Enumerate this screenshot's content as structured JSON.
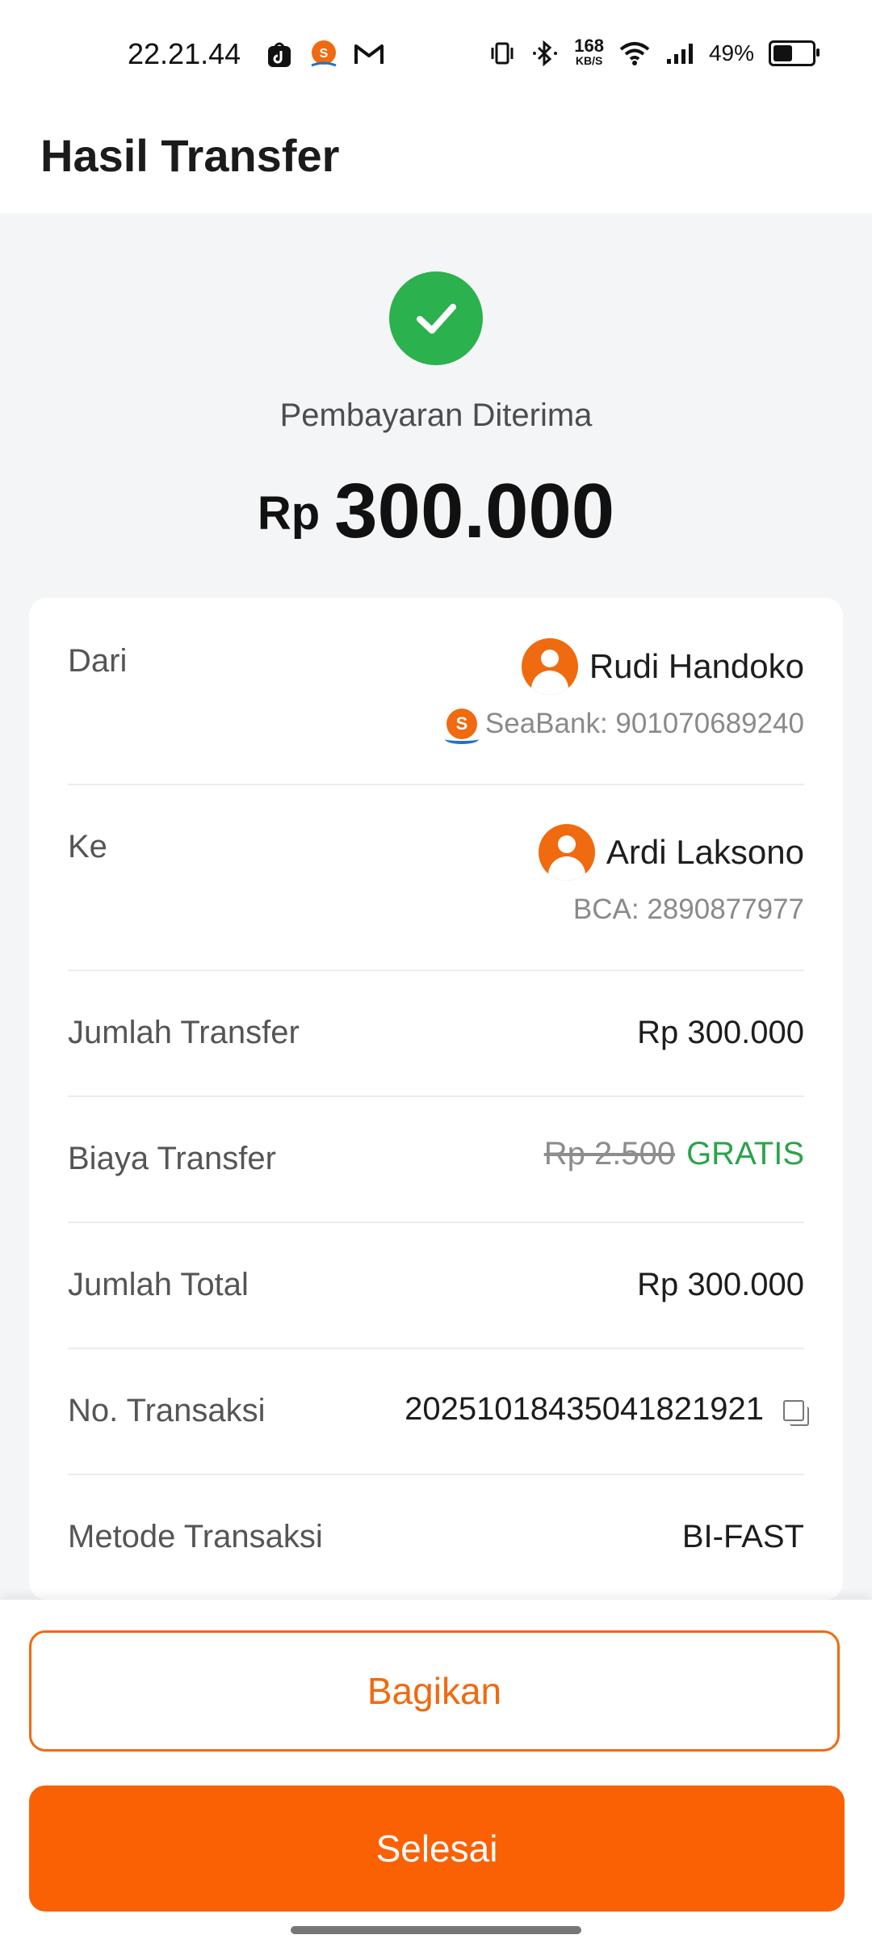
{
  "status_bar": {
    "time": "22.21.44",
    "net_speed_value": "168",
    "net_speed_unit": "KB/S",
    "battery_percent": "49%",
    "battery_level": 0.49
  },
  "header": {
    "title": "Hasil Transfer"
  },
  "result": {
    "status_text": "Pembayaran Diterima",
    "currency": "Rp",
    "amount": "300.000"
  },
  "details": {
    "from": {
      "label": "Dari",
      "name": "Rudi Handoko",
      "bank_account": "SeaBank: 901070689240"
    },
    "to": {
      "label": "Ke",
      "name": "Ardi Laksono",
      "bank_account": "BCA: 2890877977"
    },
    "transfer_amount": {
      "label": "Jumlah Transfer",
      "value": "Rp 300.000"
    },
    "transfer_fee": {
      "label": "Biaya Transfer",
      "original": "Rp 2.500",
      "value": "GRATIS"
    },
    "total": {
      "label": "Jumlah Total",
      "value": "Rp 300.000"
    },
    "transaction_no": {
      "label": "No. Transaksi",
      "value": "20251018435041821921"
    },
    "method": {
      "label": "Metode Transaksi",
      "value": "BI-FAST"
    }
  },
  "actions": {
    "share_label": "Bagikan",
    "done_label": "Selesai"
  },
  "colors": {
    "accent": "#fa6004",
    "success": "#2bb14d",
    "free": "#2aa44a"
  }
}
